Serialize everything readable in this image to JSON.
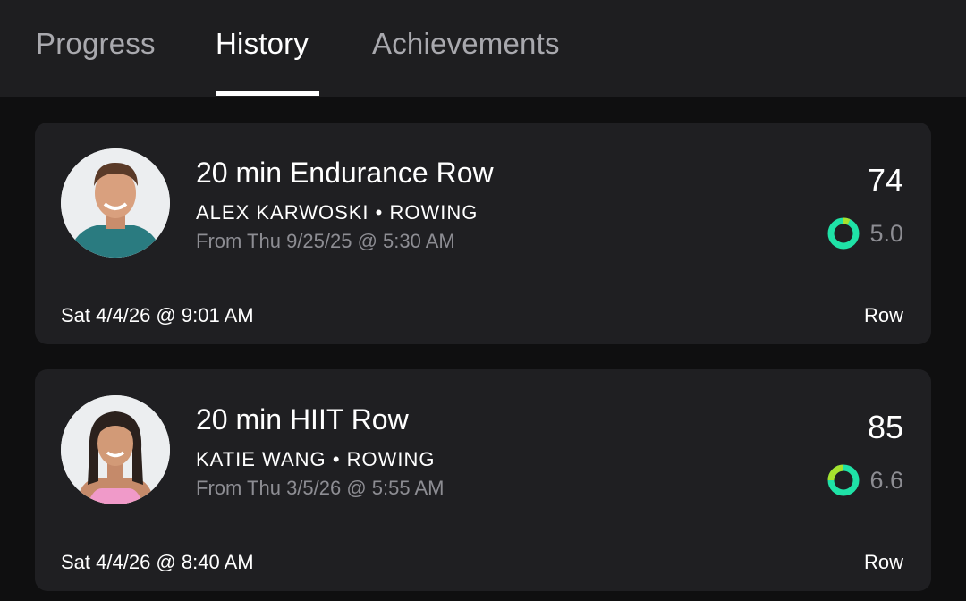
{
  "tabs": [
    {
      "label": "Progress",
      "active": false
    },
    {
      "label": "History",
      "active": true
    },
    {
      "label": "Achievements",
      "active": false
    }
  ],
  "workouts": [
    {
      "title": "20 min Endurance Row",
      "instructor": "ALEX KARWOSKI",
      "separator": "•",
      "category": "ROWING",
      "from_text": "From Thu 9/25/25 @ 5:30 AM",
      "score": "74",
      "rating": "5.0",
      "date": "Sat 4/4/26 @ 9:01 AM",
      "discipline": "Row",
      "avatar_icon": "instructor-avatar-male"
    },
    {
      "title": "20 min HIIT Row",
      "instructor": "KATIE WANG",
      "separator": "•",
      "category": "ROWING",
      "from_text": "From Thu 3/5/26 @ 5:55 AM",
      "score": "85",
      "rating": "6.6",
      "date": "Sat 4/4/26 @ 8:40 AM",
      "discipline": "Row",
      "avatar_icon": "instructor-avatar-female"
    }
  ],
  "colors": {
    "ring_primary": "#1fe2a7",
    "ring_accent": "#a6e22e",
    "card_bg": "#1f1f22",
    "page_bg": "#0f0f10"
  }
}
